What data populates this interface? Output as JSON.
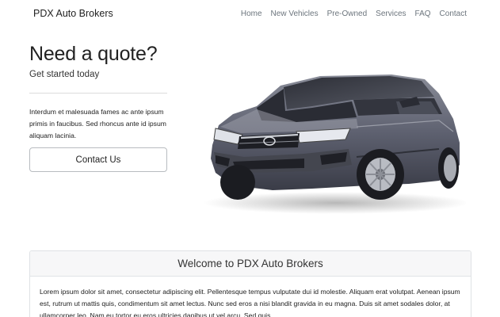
{
  "navbar": {
    "brand": "PDX Auto Brokers",
    "links": [
      "Home",
      "New Vehicles",
      "Pre-Owned",
      "Services",
      "FAQ",
      "Contact"
    ]
  },
  "hero": {
    "title": "Need a quote?",
    "subtitle": "Get started today",
    "text": "Interdum et malesuada fames ac ante ipsum primis in faucibus. Sed rhoncus ante id ipsum aliquam lacinia.",
    "button_label": "Contact Us",
    "image": "silver-honda-crv-suv"
  },
  "welcome": {
    "title": "Welcome to PDX Auto Brokers",
    "body": "Lorem ipsum dolor sit amet, consectetur adipiscing elit. Pellentesque tempus vulputate dui id molestie. Aliquam erat volutpat. Aenean ipsum est, rutrum ut mattis quis, condimentum sit amet lectus. Nunc sed eros a nisi blandit gravida in eu magna. Duis sit amet sodales dolor, at ullamcorper leo. Nam eu tortor eu eros ultricies dapibus ut vel arcu. Sed quis"
  }
}
